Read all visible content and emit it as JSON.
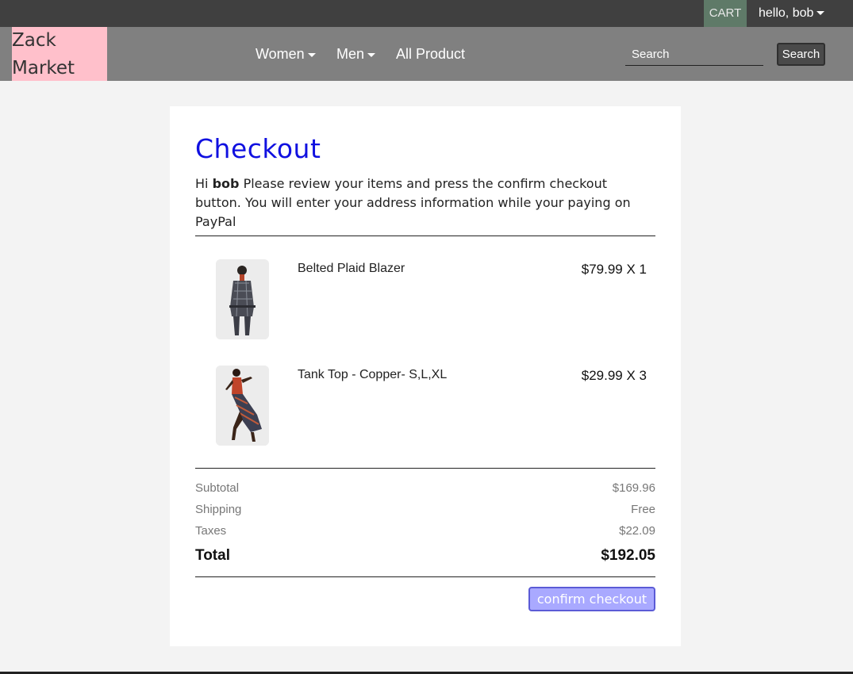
{
  "topbar": {
    "cart_label": "CART",
    "user_label": "hello, bob"
  },
  "navbar": {
    "logo_line1": "Zack",
    "logo_line2": "Market",
    "menu": [
      {
        "label": "Women",
        "dropdown": true
      },
      {
        "label": "Men",
        "dropdown": true
      },
      {
        "label": "All Product",
        "dropdown": false
      }
    ],
    "search_placeholder": "Search",
    "search_button": "Search"
  },
  "checkout": {
    "title": "Checkout",
    "intro_prefix": "Hi",
    "username": "bob",
    "intro_rest": "Please review your items and press the confirm checkout button. You will enter your address information while your paying on PayPal",
    "items": [
      {
        "name": "Belted Plaid Blazer",
        "price": "$79.99 X 1"
      },
      {
        "name": "Tank Top - Copper- S,L,XL",
        "price": "$29.99 X 3"
      }
    ],
    "summary": {
      "subtotal_label": "Subtotal",
      "subtotal_value": "$169.96",
      "shipping_label": "Shipping",
      "shipping_value": "Free",
      "taxes_label": "Taxes",
      "taxes_value": "$22.09",
      "total_label": "Total",
      "total_value": "$192.05"
    },
    "confirm_button": "confirm checkout"
  },
  "colors": {
    "accent_title": "#1010e0",
    "logo_bg": "#ffc0cb",
    "cart_bg": "#5f7a68",
    "confirm_bg": "#a9a9ff"
  }
}
